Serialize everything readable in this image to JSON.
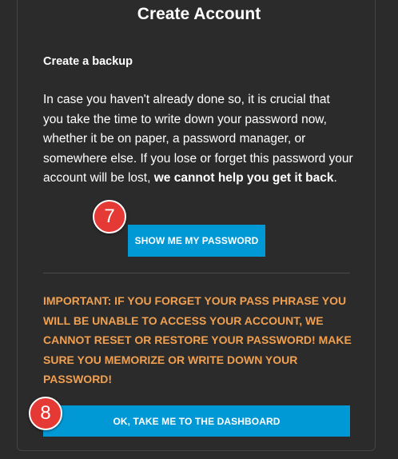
{
  "page": {
    "title": "Create Account"
  },
  "backup": {
    "heading": "Create a backup",
    "body_normal": "In case you haven't already done so, it is crucial that you take the time to write down your password now, whether it be on paper, a password manager, or somewhere else. If you lose or forget this password your account will be lost, ",
    "body_bold": "we cannot help you get it back",
    "body_end": ".",
    "show_password_button": "SHOW ME MY PASSWORD"
  },
  "warning": {
    "text": "IMPORTANT: IF YOU FORGET YOUR PASS PHRASE YOU WILL BE UNABLE TO ACCESS YOUR ACCOUNT, WE CANNOT RESET OR RESTORE YOUR PASSWORD! MAKE SURE YOU MEMORIZE OR WRITE DOWN YOUR PASSWORD!"
  },
  "dashboard_button": "OK, TAKE ME TO THE DASHBOARD",
  "badges": {
    "step_7": "7",
    "step_8": "8"
  },
  "colors": {
    "background": "#2b2b2b",
    "button": "#0099d6",
    "warning": "#f0a050",
    "badge": "#e53935"
  }
}
